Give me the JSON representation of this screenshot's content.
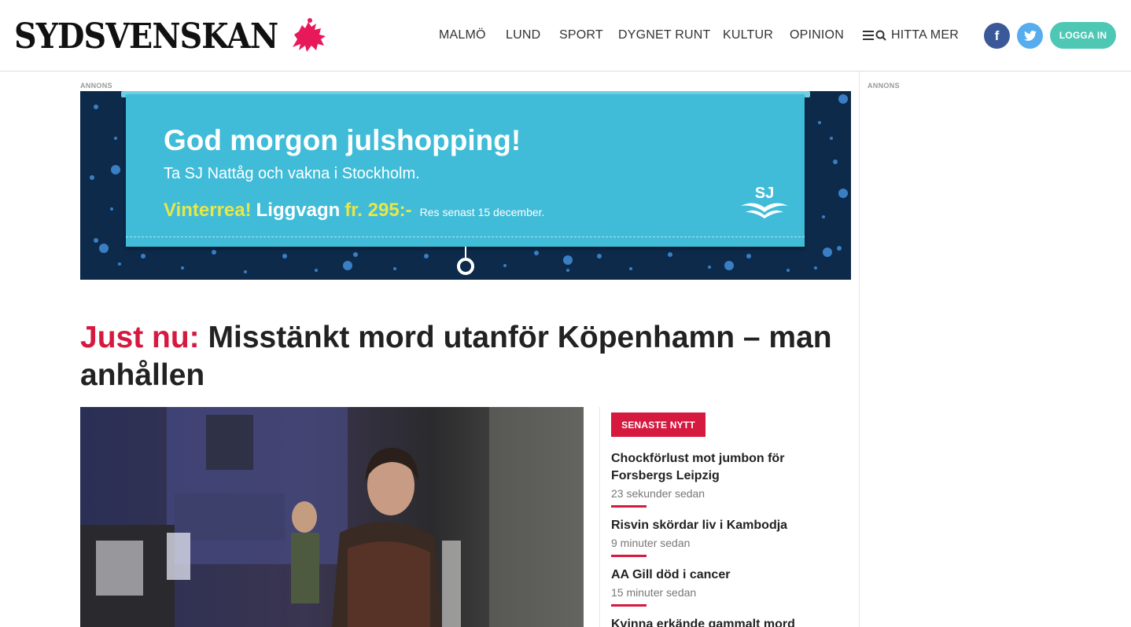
{
  "header": {
    "logo_text": "SYDSVENSKAN",
    "nav": [
      "MALMÖ",
      "LUND",
      "SPORT",
      "DYGNET RUNT",
      "KULTUR",
      "OPINION"
    ],
    "hitta_mer": "HITTA MER",
    "facebook_glyph": "f",
    "login_label": "LOGGA IN",
    "colors": {
      "facebook": "#3b5998",
      "twitter": "#55acee",
      "login": "#4ec7b5",
      "brand": "#e8195a"
    }
  },
  "ads": {
    "main_label": "ANNONS",
    "side_label": "ANNONS",
    "banner": {
      "headline": "God morgon julshopping!",
      "subline": "Ta SJ Nattåg och vakna i Stockholm.",
      "offer_part1": "Vinterrea!",
      "offer_part2": "Liggvagn",
      "offer_part3": "fr. 295:-",
      "offer_note": "Res senast 15 december.",
      "brand": "SJ",
      "colors": {
        "panel": "#40bcd8",
        "background": "#0d2a4a",
        "highlight": "#e7e64a"
      }
    }
  },
  "main": {
    "headline_prefix": "Just nu:",
    "headline_text": "Misstänkt mord utanför Köpenhamn – man anhållen",
    "accent_color": "#d5193f"
  },
  "latest_news": {
    "label": "SENASTE NYTT",
    "items": [
      {
        "title": "Chockförlust mot jumbon för Forsbergs Leipzig",
        "time": "23 sekunder sedan"
      },
      {
        "title": "Risvin skördar liv i Kambodja",
        "time": "9 minuter sedan"
      },
      {
        "title": "AA Gill död i cancer",
        "time": "15 minuter sedan"
      },
      {
        "title": "Kvinna erkände gammalt mord",
        "time": ""
      }
    ]
  }
}
